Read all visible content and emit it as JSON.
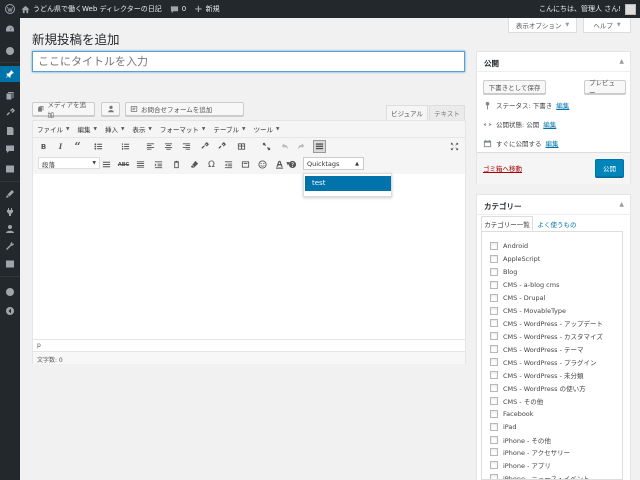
{
  "adminbar": {
    "site_name": "うどん県で働くWeb ディレクターの日記",
    "comments_count": "0",
    "new_label": "新規",
    "greeting": "こんにちは、管理人 さん!"
  },
  "screen_options": {
    "options_label": "表示オプション",
    "help_label": "ヘルプ"
  },
  "page_title": "新規投稿を追加",
  "title_field": {
    "placeholder": "ここにタイトルを入力"
  },
  "media_buttons": {
    "add_media": "メディアを追加",
    "add_contact_form": "お問合せフォームを追加"
  },
  "editor_tabs": {
    "visual": "ビジュアル",
    "text": "テキスト"
  },
  "menubar": [
    "ファイル",
    "編集",
    "挿入",
    "表示",
    "フォーマット",
    "テーブル",
    "ツール"
  ],
  "toolbar": {
    "format_value": "段落",
    "quicktags_value": "Quicktags",
    "quicktags_option": "test",
    "bold": "B",
    "italic": "I",
    "quote": "“"
  },
  "editor": {
    "path": "p",
    "word_count": "文字数: 0"
  },
  "publish": {
    "title": "公開",
    "save_draft": "下書きとして保存",
    "preview": "プレビュー",
    "status_label": "ステータス: 下書き",
    "status_edit": "編集",
    "visibility_label": "公開状態: 公開",
    "visibility_edit": "編集",
    "schedule_label": "すぐに公開する",
    "schedule_edit": "編集",
    "trash": "ゴミ箱へ移動",
    "publish_button": "公開"
  },
  "categories": {
    "title": "カテゴリー",
    "tab_all": "カテゴリー一覧",
    "tab_popular": "よく使うもの",
    "items": [
      "Android",
      "AppleScript",
      "Blog",
      "CMS - a-blog cms",
      "CMS - Drupal",
      "CMS - MovableType",
      "CMS - WordPress - アップデート",
      "CMS - WordPress - カスタマイズ",
      "CMS - WordPress - テーマ",
      "CMS - WordPress - プラグイン",
      "CMS - WordPress - 未分類",
      "CMS - WordPress の使い方",
      "CMS - その他",
      "Facebook",
      "iPad",
      "iPhone - その他",
      "iPhone - アクセサリー",
      "iPhone - アプリ",
      "iPhone - ニュース・イベント"
    ]
  },
  "colors": {
    "adminbar_bg": "#23282d",
    "accent": "#0073aa",
    "trash": "#a00",
    "publish_button": "#0085ba"
  }
}
